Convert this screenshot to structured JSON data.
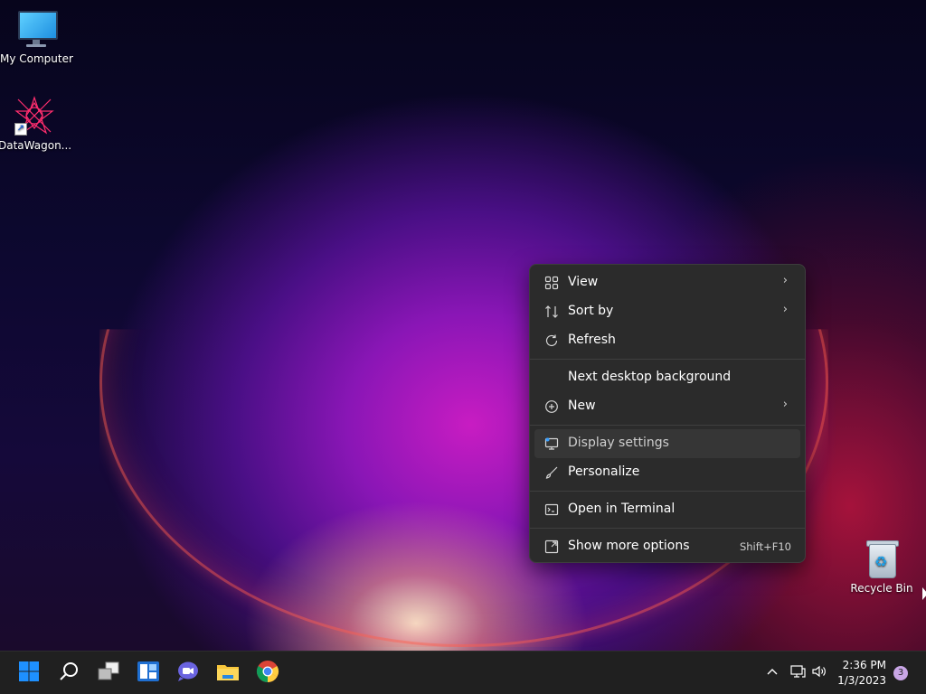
{
  "desktop": {
    "icons": [
      {
        "label": "My Computer"
      },
      {
        "label": "DataWagon..."
      },
      {
        "label": "Recycle Bin"
      }
    ]
  },
  "context_menu": {
    "items": {
      "view": {
        "label": "View",
        "icon": "grid-icon"
      },
      "sort_by": {
        "label": "Sort by",
        "icon": "sort-arrows-icon"
      },
      "refresh": {
        "label": "Refresh",
        "icon": "refresh-icon"
      },
      "next_background": {
        "label": "Next desktop background"
      },
      "new": {
        "label": "New",
        "icon": "plus-circle-icon"
      },
      "display_settings": {
        "label": "Display settings",
        "icon": "display-icon"
      },
      "personalize": {
        "label": "Personalize",
        "icon": "brush-icon"
      },
      "open_terminal": {
        "label": "Open in Terminal",
        "icon": "terminal-icon"
      },
      "show_more": {
        "label": "Show more options",
        "icon": "expand-icon",
        "shortcut": "Shift+F10"
      }
    }
  },
  "taskbar": {
    "apps": [
      "start-icon",
      "search-icon",
      "task-view-icon",
      "widgets-icon",
      "teams-chat-icon",
      "file-explorer-icon",
      "chrome-icon"
    ],
    "clock": {
      "time": "2:36 PM",
      "date": "1/3/2023"
    },
    "notification_count": "3"
  },
  "colors": {
    "menu_bg": "#2b2b2b",
    "taskbar_bg": "#202020",
    "accent": "#0078d4"
  }
}
